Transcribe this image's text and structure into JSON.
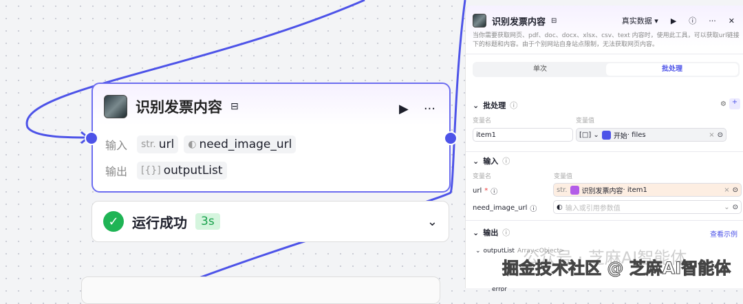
{
  "node": {
    "title": "识别发票内容",
    "input_label": "输入",
    "output_label": "输出",
    "inputs": [
      {
        "type": "str.",
        "name": "url"
      },
      {
        "type": "toggle",
        "name": "need_image_url"
      }
    ],
    "outputs": [
      {
        "type": "[{}]",
        "name": "outputList"
      }
    ]
  },
  "status": {
    "text": "运行成功",
    "time": "3s"
  },
  "panel": {
    "title": "识别发票内容",
    "data_mode": "真实数据 ▾",
    "description": "当你需要获取网页、pdf、doc、docx、xlsx、csv、text 内容时，使用此工具，可以获取url链接下的标题和内容。由于个别网站自身站点限制，无法获取网页内容。",
    "tabs": [
      "单次",
      "批处理"
    ],
    "batch": {
      "title": "批处理",
      "col_name": "变量名",
      "col_value": "变量值",
      "var_name": "item1",
      "ref_node": "开始",
      "ref_field": " · files"
    },
    "input": {
      "title": "输入",
      "col_name": "变量名",
      "col_value": "变量值",
      "url_label": "url",
      "url_ref_node": "识别发票内容",
      "url_ref_field": " · item1",
      "need_label": "need_image_url",
      "need_placeholder": "输入或引用参数值"
    },
    "output": {
      "title": "输出",
      "example_link": "查看示例",
      "item": "outputList",
      "item_type": "Array<Object>",
      "child": "error"
    }
  },
  "watermark": {
    "line1": "公众号 · 芝麻AI智能体",
    "line2": "掘金技术社区 @ 芝麻AI智能体"
  }
}
